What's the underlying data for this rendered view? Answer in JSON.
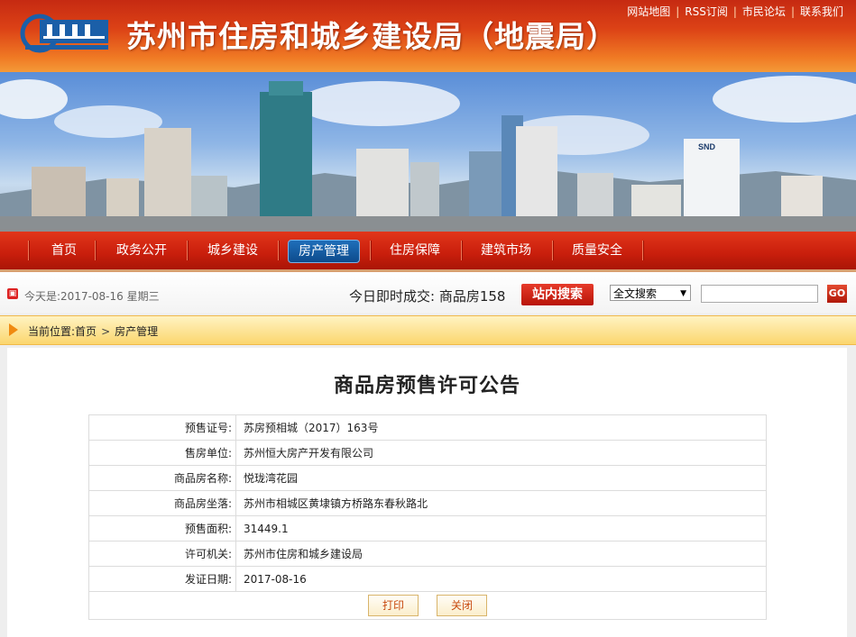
{
  "header": {
    "site_title": "苏州市住房和城乡建设局（地震局）",
    "top_links": [
      "网站地图",
      "RSS订阅",
      "市民论坛",
      "联系我们"
    ]
  },
  "banner": {
    "building_sign": "SND"
  },
  "nav": {
    "items": [
      {
        "label": "首页"
      },
      {
        "label": "政务公开"
      },
      {
        "label": "城乡建设"
      },
      {
        "label": "房产管理",
        "active": true
      },
      {
        "label": "住房保障"
      },
      {
        "label": "建筑市场"
      },
      {
        "label": "质量安全"
      }
    ]
  },
  "infobar": {
    "date_text": "今天是:2017-08-16 星期三",
    "ticker_text": "今日即时成交: 商品房158",
    "search_button": "站内搜索",
    "search_scope": "全文搜索",
    "go_label": "GO"
  },
  "breadcrumb": {
    "prefix": "当前位置:",
    "items": [
      "首页",
      "房产管理"
    ]
  },
  "notice": {
    "title": "商品房预售许可公告",
    "rows": [
      {
        "label": "预售证号:",
        "value": "苏房预相城（2017）163号"
      },
      {
        "label": "售房单位:",
        "value": "苏州恒大房产开发有限公司"
      },
      {
        "label": "商品房名称:",
        "value": "悦珑湾花园"
      },
      {
        "label": "商品房坐落:",
        "value": "苏州市相城区黄埭镇方桥路东春秋路北"
      },
      {
        "label": "预售面积:",
        "value": "31449.1"
      },
      {
        "label": "许可机关:",
        "value": "苏州市住房和城乡建设局"
      },
      {
        "label": "发证日期:",
        "value": " 2017-08-16"
      }
    ],
    "print_button": "打印",
    "close_button": "关闭"
  },
  "colors": {
    "header_red": "#d23a14",
    "nav_red": "#c81e0c",
    "active_tab": "#1f6fba",
    "breadcrumb_yellow": "#fbd66e"
  }
}
